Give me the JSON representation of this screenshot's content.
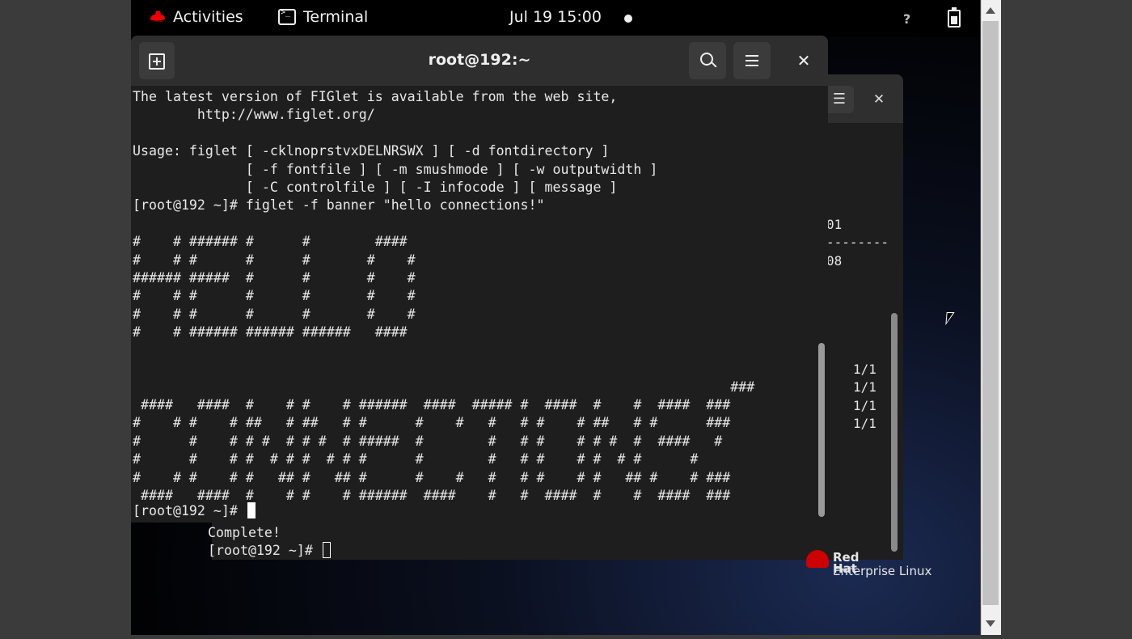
{
  "topbar": {
    "activities_label": "Activities",
    "app_label": "Terminal",
    "clock": "Jul 19  15:00"
  },
  "main_terminal": {
    "title": "root@192:~",
    "output": "The latest version of FIGlet is available from the web site,\n        http://www.figlet.org/\n\nUsage: figlet [ -cklnoprstvxDELNRSWX ] [ -d fontdirectory ]\n              [ -f fontfile ] [ -m smushmode ] [ -w outputwidth ]\n              [ -C controlfile ] [ -I infocode ] [ message ]\n[root@192 ~]# figlet -f banner \"hello connections!\"\n\n#    # ###### #      #        ####\n#    # #      #      #       #    #\n###### #####  #      #       #    #\n#    # #      #      #       #    #\n#    # #      #      #       #    #\n#    # ###### ###### ######   ####\n\n\n                                                                          ###\n ####   ####  #    # #    # ######  ####  ##### #  ####  #    #  ####  ###\n#    # #    # ##   # ##   # #      #    #   #   # #    # ##   # #      ###\n#      #    # # #  # # #  # #####  #        #   # #    # # #  #  ####   #\n#      #    # #  # # #  # # #      #        #   # #    # #  # #      #\n#    # #    # #   ## #   ## #      #    #   #   # #    # #   ## #    # ###\n ####   ####  #    # #    # ######  ####    #   #  ####  #    #  ####  ###",
    "prompt": "[root@192 ~]# "
  },
  "background_terminal": {
    "fragments": [
      "01",
      "--------",
      "08",
      "1/1",
      "1/1",
      "1/1",
      "1/1"
    ],
    "complete_text": "Complete!",
    "prompt": "[root@192 ~]# "
  },
  "logo": {
    "brand": "Red Hat",
    "product": "Enterprise Linux"
  },
  "colors": {
    "redhat_red": "#cc0000",
    "terminal_bg": "#1e1e1e",
    "header_bg": "#2e2e2e"
  }
}
